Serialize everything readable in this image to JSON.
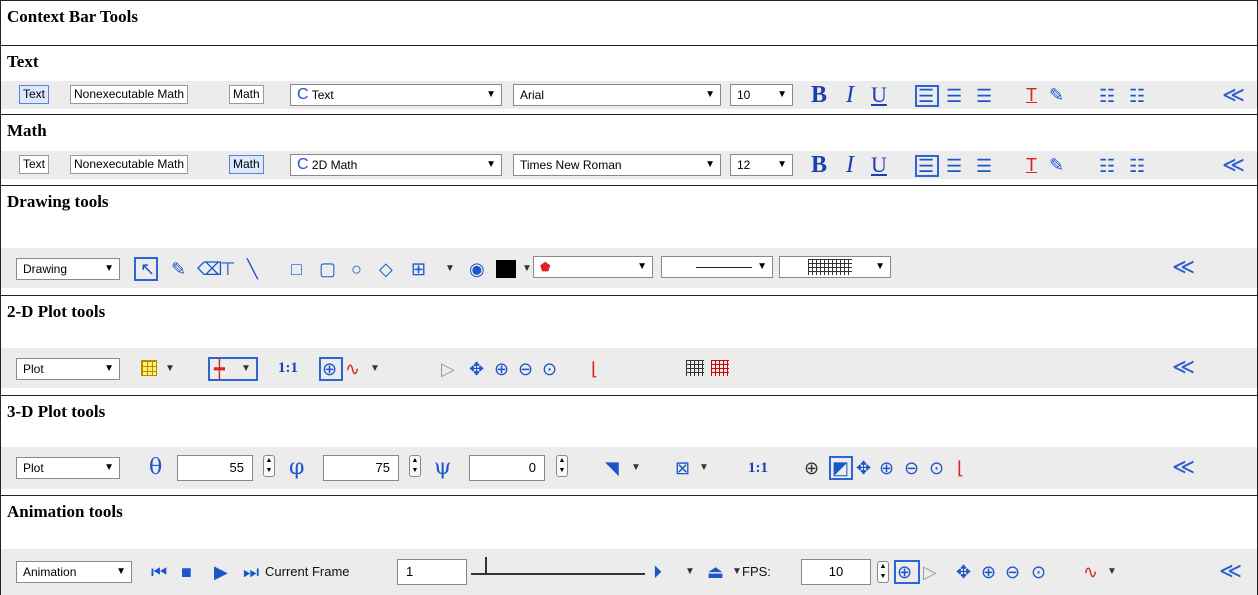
{
  "title": "Context Bar Tools",
  "sections": {
    "text": {
      "heading": "Text",
      "mode_buttons": [
        "Text",
        "Nonexecutable Math",
        "Math"
      ],
      "style_value": "Text",
      "font_value": "Arial",
      "size_value": "10"
    },
    "math": {
      "heading": "Math",
      "mode_buttons": [
        "Text",
        "Nonexecutable Math",
        "Math"
      ],
      "style_value": "2D Math",
      "font_value": "Times New Roman",
      "size_value": "12"
    },
    "drawing": {
      "heading": "Drawing tools",
      "mode_value": "Drawing"
    },
    "plot2d": {
      "heading": "2-D Plot tools",
      "mode_value": "Plot",
      "ratio_label": "1:1"
    },
    "plot3d": {
      "heading": "3-D Plot tools",
      "mode_value": "Plot",
      "theta_value": "55",
      "phi_value": "75",
      "psi_value": "0",
      "ratio_label": "1:1"
    },
    "animation": {
      "heading": "Animation tools",
      "mode_value": "Animation",
      "current_frame_label": "Current Frame",
      "current_frame_value": "1",
      "fps_label": "FPS:",
      "fps_value": "10"
    }
  },
  "glyphs": {
    "bold": "B",
    "italic": "I",
    "underline": "U",
    "collapse": "≪",
    "style_prefix": "C",
    "theta": "θ",
    "phi": "φ",
    "psi": "ψ"
  },
  "colors": {
    "accent": "#1a56c9",
    "bar_background": "#ececec",
    "selected": "#dce8ff"
  }
}
